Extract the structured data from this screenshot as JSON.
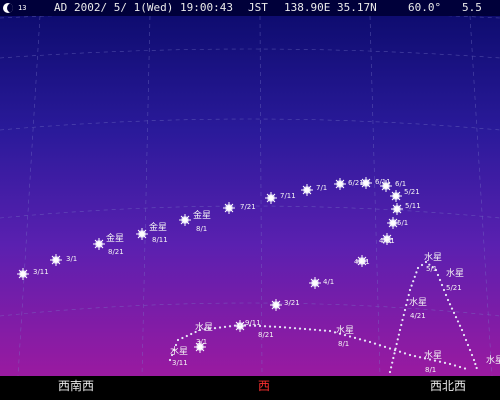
{
  "status_bar": {
    "moon_age": "13",
    "era": "AD",
    "date": "2002/ 5/ 1(Wed)",
    "time": "19:00:43",
    "tz": "JST",
    "location": "138.90E 35.17N",
    "field_of_view": "60.0°",
    "limit_mag": "5.5"
  },
  "horizon": {
    "west_southwest": "西南西",
    "west": "西",
    "west_northwest": "西北西"
  },
  "planet_names": {
    "venus": "金星",
    "mercury": "水星"
  },
  "venus_path_dates": [
    "3/11",
    "3/1",
    "8/21",
    "8/11",
    "8/1",
    "7/21",
    "7/11",
    "7/1",
    "6/21",
    "6/11",
    "6/1",
    "5/21",
    "5/11",
    "5/1",
    "4/21",
    "4/11",
    "4/1",
    "3/21",
    "3/11",
    "3/1"
  ],
  "mercury_path_dates": [
    "3/11",
    "3/1",
    "9/11",
    "8/21",
    "8/1",
    "5/1",
    "5/11",
    "4/21",
    "8/1",
    "5/21"
  ],
  "colors": {
    "sky_top": "#0a0a6a",
    "sky_bottom": "#9a1aa0",
    "horizon_west": "#ff3030",
    "label": "#f4f4f4"
  }
}
